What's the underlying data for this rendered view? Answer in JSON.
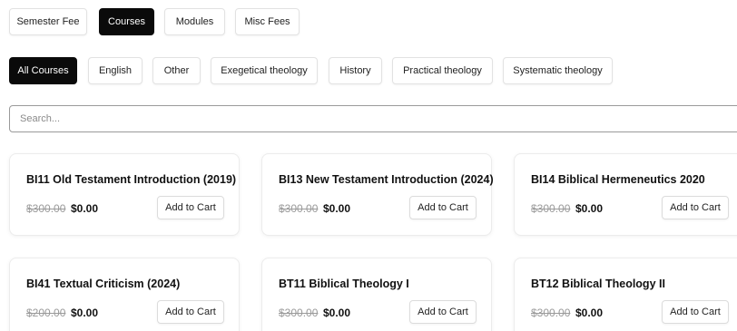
{
  "fee_tabs": [
    {
      "label": "Semester Fee",
      "active": false
    },
    {
      "label": "Courses",
      "active": true
    },
    {
      "label": "Modules",
      "active": false
    },
    {
      "label": "Misc Fees",
      "active": false
    }
  ],
  "categories": [
    {
      "label": "All Courses",
      "active": true
    },
    {
      "label": "English",
      "active": false
    },
    {
      "label": "Other",
      "active": false
    },
    {
      "label": "Exegetical theology",
      "active": false
    },
    {
      "label": "History",
      "active": false
    },
    {
      "label": "Practical theology",
      "active": false
    },
    {
      "label": "Systematic theology",
      "active": false
    }
  ],
  "search": {
    "placeholder": "Search...",
    "value": ""
  },
  "courses": [
    {
      "title": "BI11 Old Testament Introduction (2019)",
      "old_price": "$300.00",
      "price": "$0.00",
      "action": "Add to Cart"
    },
    {
      "title": "BI13 New Testament Introduction (2024)",
      "old_price": "$300.00",
      "price": "$0.00",
      "action": "Add to Cart"
    },
    {
      "title": "BI14 Biblical Hermeneutics 2020",
      "old_price": "$300.00",
      "price": "$0.00",
      "action": "Add to Cart"
    },
    {
      "title": "BI41 Textual Criticism (2024)",
      "old_price": "$200.00",
      "price": "$0.00",
      "action": "Add to Cart"
    },
    {
      "title": "BT11 Biblical Theology I",
      "old_price": "$300.00",
      "price": "$0.00",
      "action": "Add to Cart"
    },
    {
      "title": "BT12 Biblical Theology II",
      "old_price": "$300.00",
      "price": "$0.00",
      "action": "Add to Cart"
    }
  ],
  "colors": {
    "active_bg": "#0a0a0a",
    "strike_price": "#9a9a9a",
    "border": "#e2e2e2"
  }
}
